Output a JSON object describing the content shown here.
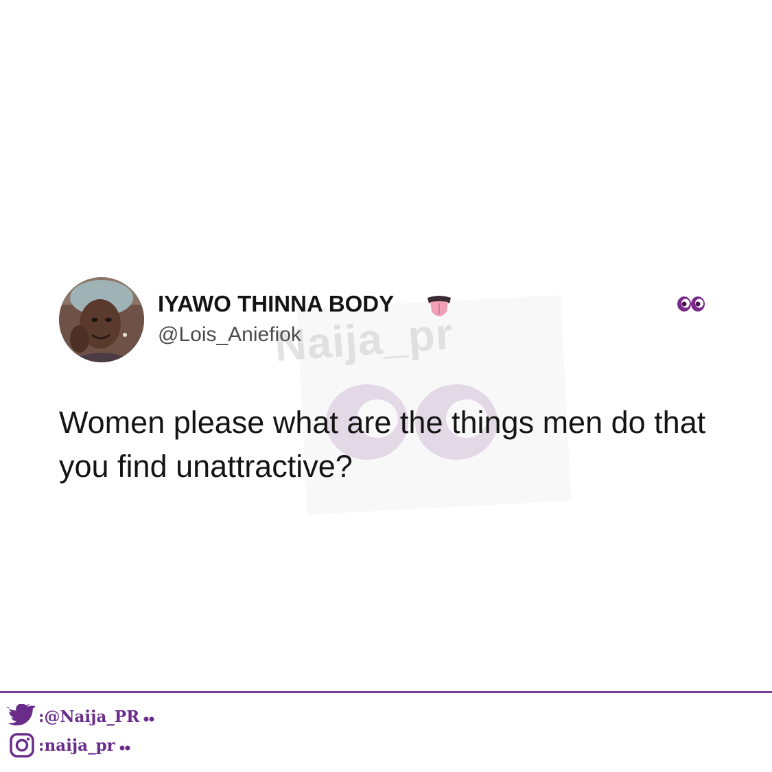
{
  "tweet": {
    "display_name": "IYAWO THINNA BODY",
    "name_emoji": "tongue-out-emoji",
    "handle": "@Lois_Aniefiok",
    "text": "Women please what are the things men do that you find unattractive?"
  },
  "watermark": {
    "text": "Naija_pr"
  },
  "footer": {
    "twitter_label": ":@Naija_PR",
    "instagram_label": ":naija_pr",
    "accent_color": "#7b3f98"
  },
  "icons": {
    "brand_eyes": "eyes-icon",
    "twitter": "twitter-bird-icon",
    "instagram": "instagram-icon"
  }
}
